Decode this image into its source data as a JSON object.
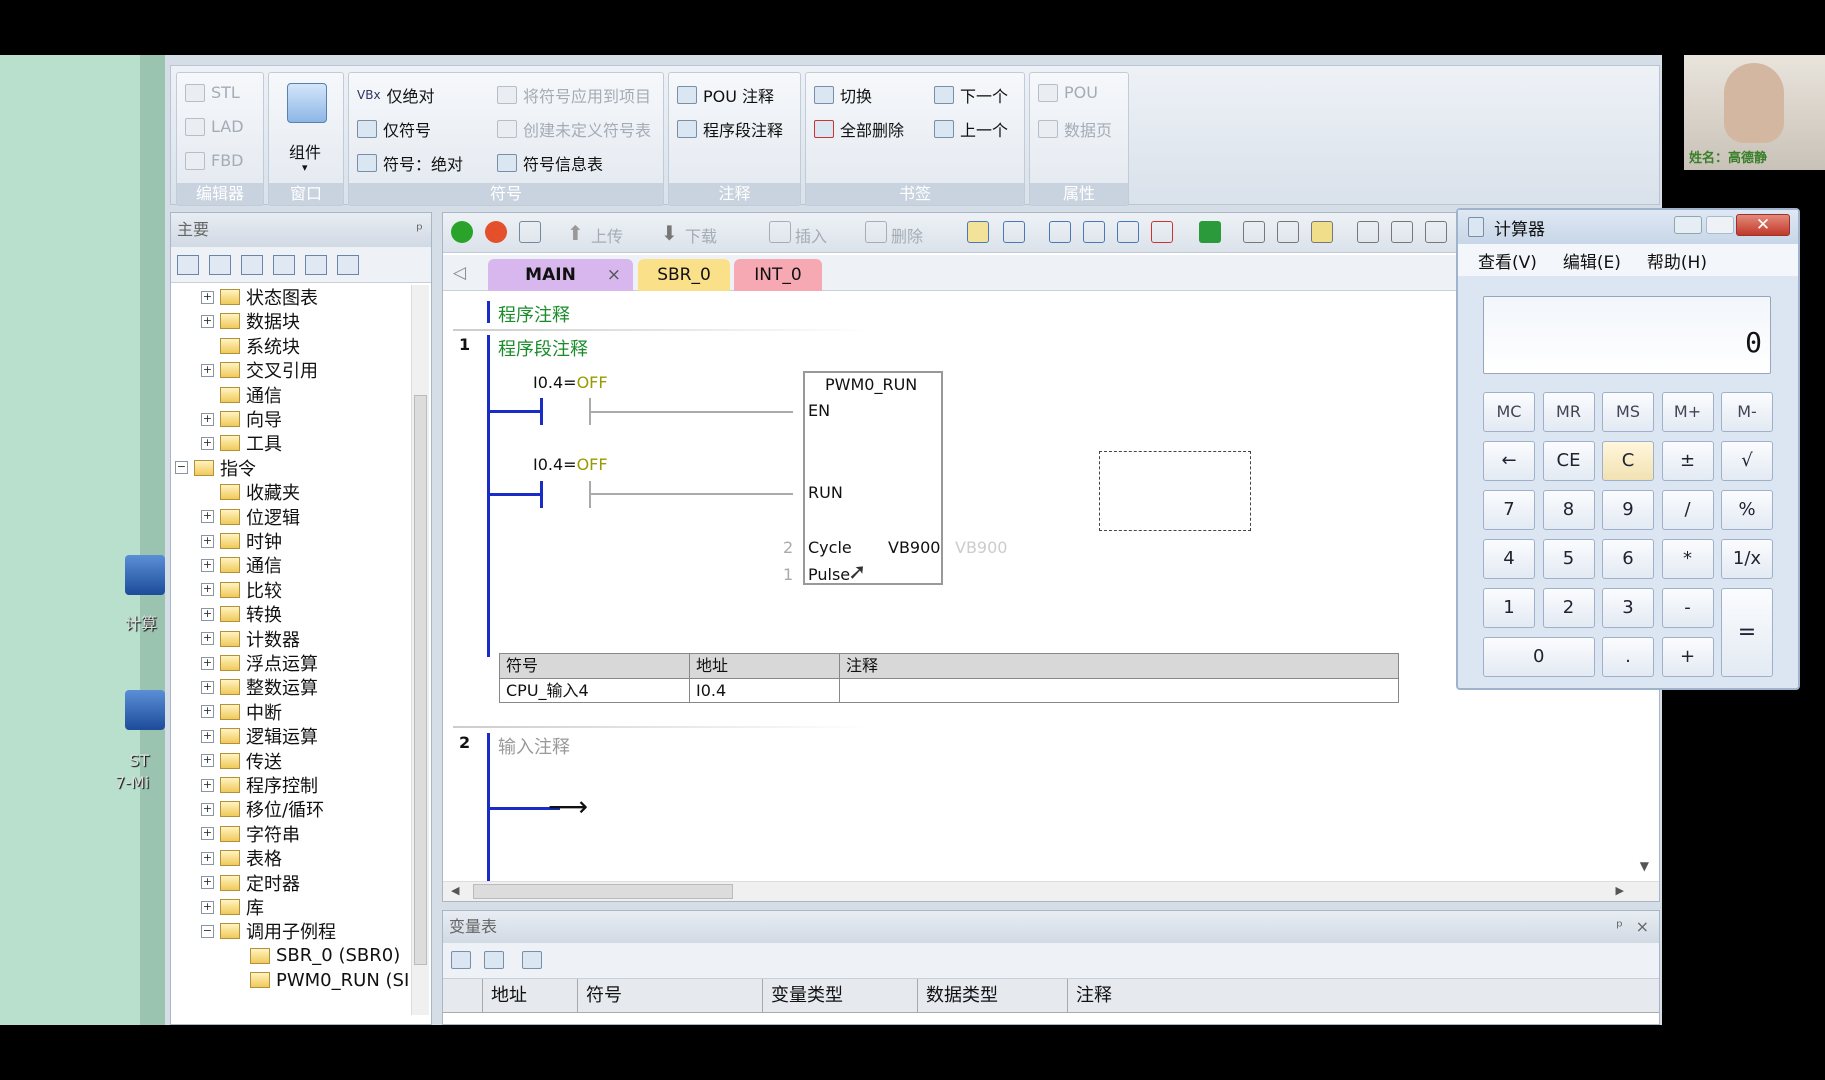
{
  "ribbon": {
    "editor": {
      "items": [
        "STL",
        "LAD",
        "FBD"
      ],
      "title": "编辑器"
    },
    "window": {
      "component": "组件",
      "title": "窗口"
    },
    "symbols": {
      "items": [
        "仅绝对",
        "仅符号",
        "符号：绝对"
      ],
      "apply": "将符号应用到项目",
      "create": "创建未定义符号表",
      "info": "符号信息表",
      "title": "符号"
    },
    "comments": {
      "pou": "POU 注释",
      "network": "程序段注释",
      "title": "注释"
    },
    "bookmarks": {
      "toggle": "切换",
      "delete_all": "全部删除",
      "next": "下一个",
      "prev": "上一个",
      "title": "书签"
    },
    "properties": {
      "pou": "POU",
      "data_page": "数据页",
      "title": "属性"
    },
    "vbx": "VBx"
  },
  "left_panel": {
    "title": "主要",
    "pin": "ᵖ",
    "tree": [
      {
        "label": "状态图表",
        "level": 1,
        "expand": "+"
      },
      {
        "label": "数据块",
        "level": 1,
        "expand": "+"
      },
      {
        "label": "系统块",
        "level": 1,
        "expand": ""
      },
      {
        "label": "交叉引用",
        "level": 1,
        "expand": "+"
      },
      {
        "label": "通信",
        "level": 1,
        "expand": ""
      },
      {
        "label": "向导",
        "level": 1,
        "expand": "+"
      },
      {
        "label": "工具",
        "level": 1,
        "expand": "+"
      },
      {
        "label": "指令",
        "level": 0,
        "expand": "−"
      },
      {
        "label": "收藏夹",
        "level": 1,
        "expand": ""
      },
      {
        "label": "位逻辑",
        "level": 1,
        "expand": "+"
      },
      {
        "label": "时钟",
        "level": 1,
        "expand": "+"
      },
      {
        "label": "通信",
        "level": 1,
        "expand": "+"
      },
      {
        "label": "比较",
        "level": 1,
        "expand": "+"
      },
      {
        "label": "转换",
        "level": 1,
        "expand": "+"
      },
      {
        "label": "计数器",
        "level": 1,
        "expand": "+"
      },
      {
        "label": "浮点运算",
        "level": 1,
        "expand": "+"
      },
      {
        "label": "整数运算",
        "level": 1,
        "expand": "+"
      },
      {
        "label": "中断",
        "level": 1,
        "expand": "+"
      },
      {
        "label": "逻辑运算",
        "level": 1,
        "expand": "+"
      },
      {
        "label": "传送",
        "level": 1,
        "expand": "+"
      },
      {
        "label": "程序控制",
        "level": 1,
        "expand": "+"
      },
      {
        "label": "移位/循环",
        "level": 1,
        "expand": "+"
      },
      {
        "label": "字符串",
        "level": 1,
        "expand": "+"
      },
      {
        "label": "表格",
        "level": 1,
        "expand": "+"
      },
      {
        "label": "定时器",
        "level": 1,
        "expand": "+"
      },
      {
        "label": "库",
        "level": 1,
        "expand": "+"
      },
      {
        "label": "调用子例程",
        "level": 1,
        "expand": "−"
      },
      {
        "label": "SBR_0 (SBR0)",
        "level": 2,
        "expand": ""
      },
      {
        "label": "PWM0_RUN (SI",
        "level": 2,
        "expand": ""
      }
    ]
  },
  "toolbar": {
    "upload": "上传",
    "download": "下载",
    "insert": "插入",
    "delete": "删除"
  },
  "tabs": [
    {
      "label": "MAIN",
      "close": "×",
      "color": "#d8b7ee"
    },
    {
      "label": "SBR_0",
      "close": "",
      "color": "#fbe08a"
    },
    {
      "label": "INT_0",
      "close": "",
      "color": "#f6a9b2"
    }
  ],
  "editor": {
    "program_comment": "程序注释",
    "network1": {
      "number": "1",
      "comment": "程序段注释",
      "contact1": "I0.4=OFF",
      "contact2": "I0.4=OFF",
      "block_name": "PWM0_RUN",
      "pin_en": "EN",
      "pin_run": "RUN",
      "pin_cycle": "Cycle",
      "pin_pulse": "Pulse",
      "cycle_value": "2",
      "pulse_value": "1",
      "out_value": "VB900",
      "out_value_ghost": "VB900"
    },
    "symtable": {
      "headers": [
        "符号",
        "地址",
        "注释"
      ],
      "row": [
        "CPU_输入4",
        "I0.4",
        ""
      ]
    },
    "network2": {
      "number": "2",
      "comment": "输入注释"
    }
  },
  "var_table": {
    "title": "变量表",
    "columns": [
      "地址",
      "符号",
      "变量类型",
      "数据类型",
      "注释"
    ]
  },
  "calculator": {
    "title": "计算器",
    "menu": [
      "查看(V)",
      "编辑(E)",
      "帮助(H)"
    ],
    "display": "0",
    "rows": [
      [
        "MC",
        "MR",
        "MS",
        "M+",
        "M-"
      ],
      [
        "←",
        "CE",
        "C",
        "±",
        "√"
      ],
      [
        "7",
        "8",
        "9",
        "/",
        "%"
      ],
      [
        "4",
        "5",
        "6",
        "*",
        "1/x"
      ],
      [
        "1",
        "2",
        "3",
        "-",
        "="
      ],
      [
        "0",
        ".",
        "+"
      ]
    ]
  },
  "desktop": {
    "icon1_label": "计算",
    "icon2_label": "ST\n7-Mi"
  },
  "webcam_caption": "姓名：高德静"
}
